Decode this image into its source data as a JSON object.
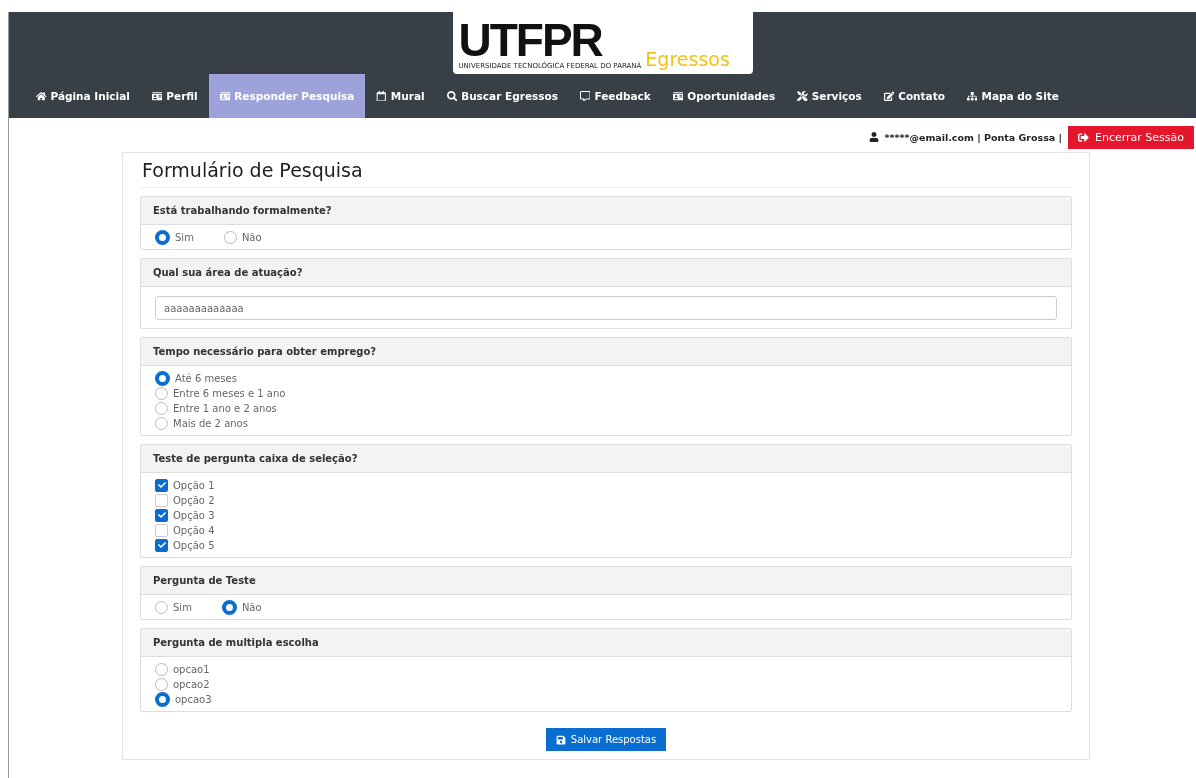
{
  "logo": {
    "mark": "UTFPR",
    "subtitle": "UNIVERSIDADE TECNOLÓGICA FEDERAL DO PARANÁ",
    "product": "Egressos"
  },
  "nav": [
    {
      "label": "Página Inicial",
      "selected": false
    },
    {
      "label": "Perfil",
      "selected": false
    },
    {
      "label": "Responder Pesquisa",
      "selected": true
    },
    {
      "label": "Mural",
      "selected": false
    },
    {
      "label": "Buscar Egressos",
      "selected": false
    },
    {
      "label": "Feedback",
      "selected": false
    },
    {
      "label": "Oportunidades",
      "selected": false
    },
    {
      "label": "Serviços",
      "selected": false
    },
    {
      "label": "Contato",
      "selected": false
    },
    {
      "label": "Mapa do Site",
      "selected": false
    }
  ],
  "user": {
    "info": "*****@email.com | Ponta Grossa |",
    "logout": "Encerrar Sessão"
  },
  "form": {
    "title": "Formulário de Pesquisa",
    "save": "Salvar Respostas"
  },
  "questions": [
    {
      "kind": "radio-inline",
      "title": "Está trabalhando formalmente?",
      "options": [
        {
          "label": "Sim",
          "selected": true
        },
        {
          "label": "Não",
          "selected": false
        }
      ]
    },
    {
      "kind": "text",
      "title": "Qual sua área de atuação?",
      "value": "aaaaaaaaaaaaa"
    },
    {
      "kind": "radio-list",
      "title": "Tempo necessário para obter emprego?",
      "options": [
        {
          "label": "Até 6 meses",
          "selected": true
        },
        {
          "label": "Entre 6 meses e 1 ano",
          "selected": false
        },
        {
          "label": "Entre 1 ano e 2 anos",
          "selected": false
        },
        {
          "label": "Mais de 2 anos",
          "selected": false
        }
      ]
    },
    {
      "kind": "checkbox-list",
      "title": "Teste de pergunta caixa de seleção?",
      "options": [
        {
          "label": "Opção 1",
          "checked": true
        },
        {
          "label": "Opção 2",
          "checked": false
        },
        {
          "label": "Opção 3",
          "checked": true
        },
        {
          "label": "Opção 4",
          "checked": false
        },
        {
          "label": "Opção 5",
          "checked": true
        }
      ]
    },
    {
      "kind": "radio-inline",
      "title": "Pergunta de Teste",
      "options": [
        {
          "label": "Sim",
          "selected": false
        },
        {
          "label": "Não",
          "selected": true
        }
      ]
    },
    {
      "kind": "radio-list",
      "title": "Pergunta de multipla escolha",
      "options": [
        {
          "label": "opcao1",
          "selected": false
        },
        {
          "label": "opcao2",
          "selected": false
        },
        {
          "label": "opcao3",
          "selected": true
        }
      ]
    }
  ]
}
